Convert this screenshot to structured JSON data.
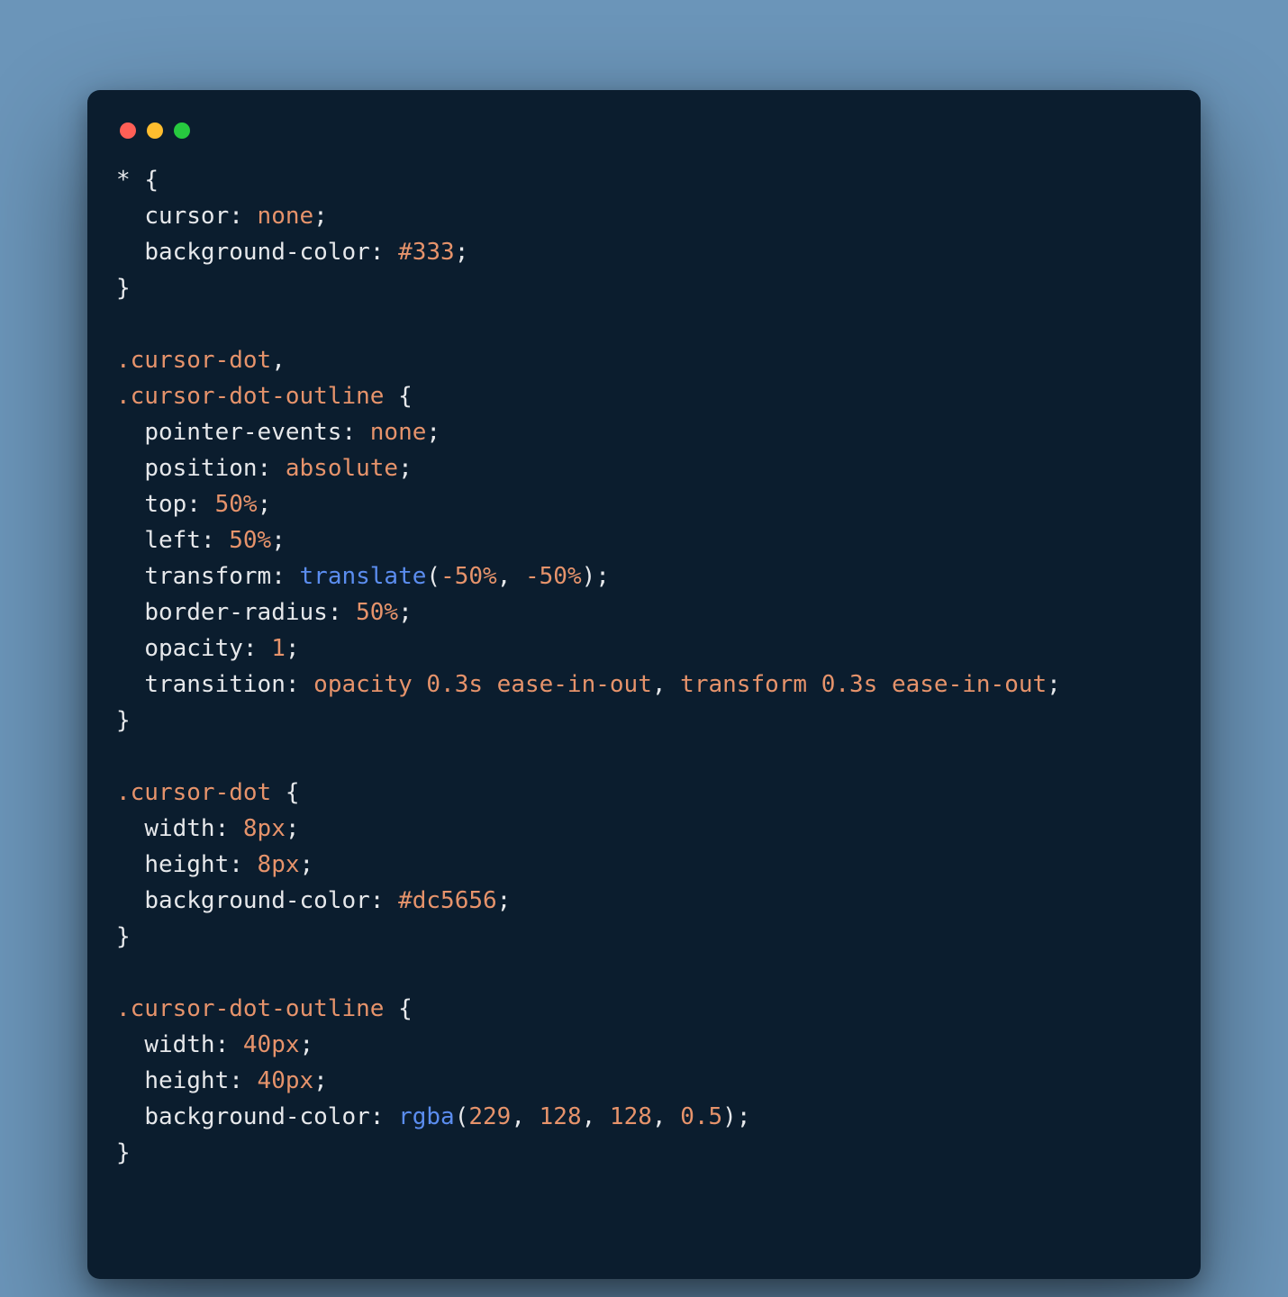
{
  "colors": {
    "bg_page": "#6b95b9",
    "bg_window": "#0b1d2e",
    "text_default": "#e6e8eb",
    "text_selector": "#e6936b",
    "text_value": "#e6936b",
    "text_func": "#5b8def",
    "tl_red": "#ff5f56",
    "tl_yellow": "#ffbd2e",
    "tl_green": "#27c93f"
  },
  "code": {
    "tokens": [
      {
        "t": "* ",
        "c": "c-punct"
      },
      {
        "t": "{",
        "c": "c-brace"
      },
      {
        "t": "\n"
      },
      {
        "t": "  "
      },
      {
        "t": "cursor",
        "c": "c-prop"
      },
      {
        "t": ": ",
        "c": "c-punct"
      },
      {
        "t": "none",
        "c": "c-val"
      },
      {
        "t": ";",
        "c": "c-punct"
      },
      {
        "t": "\n"
      },
      {
        "t": "  "
      },
      {
        "t": "background-color",
        "c": "c-prop"
      },
      {
        "t": ": ",
        "c": "c-punct"
      },
      {
        "t": "#333",
        "c": "c-val"
      },
      {
        "t": ";",
        "c": "c-punct"
      },
      {
        "t": "\n"
      },
      {
        "t": "}",
        "c": "c-brace"
      },
      {
        "t": "\n"
      },
      {
        "t": "\n"
      },
      {
        "t": ".cursor-dot",
        "c": "c-sel"
      },
      {
        "t": ",",
        "c": "c-punct"
      },
      {
        "t": "\n"
      },
      {
        "t": ".cursor-dot-outline",
        "c": "c-sel"
      },
      {
        "t": " {",
        "c": "c-brace"
      },
      {
        "t": "\n"
      },
      {
        "t": "  "
      },
      {
        "t": "pointer-events",
        "c": "c-prop"
      },
      {
        "t": ": ",
        "c": "c-punct"
      },
      {
        "t": "none",
        "c": "c-val"
      },
      {
        "t": ";",
        "c": "c-punct"
      },
      {
        "t": "\n"
      },
      {
        "t": "  "
      },
      {
        "t": "position",
        "c": "c-prop"
      },
      {
        "t": ": ",
        "c": "c-punct"
      },
      {
        "t": "absolute",
        "c": "c-val"
      },
      {
        "t": ";",
        "c": "c-punct"
      },
      {
        "t": "\n"
      },
      {
        "t": "  "
      },
      {
        "t": "top",
        "c": "c-prop"
      },
      {
        "t": ": ",
        "c": "c-punct"
      },
      {
        "t": "50%",
        "c": "c-val"
      },
      {
        "t": ";",
        "c": "c-punct"
      },
      {
        "t": "\n"
      },
      {
        "t": "  "
      },
      {
        "t": "left",
        "c": "c-prop"
      },
      {
        "t": ": ",
        "c": "c-punct"
      },
      {
        "t": "50%",
        "c": "c-val"
      },
      {
        "t": ";",
        "c": "c-punct"
      },
      {
        "t": "\n"
      },
      {
        "t": "  "
      },
      {
        "t": "transform",
        "c": "c-prop"
      },
      {
        "t": ": ",
        "c": "c-punct"
      },
      {
        "t": "translate",
        "c": "c-func"
      },
      {
        "t": "(",
        "c": "c-punct"
      },
      {
        "t": "-50%",
        "c": "c-val"
      },
      {
        "t": ", ",
        "c": "c-punct"
      },
      {
        "t": "-50%",
        "c": "c-val"
      },
      {
        "t": ")",
        "c": "c-punct"
      },
      {
        "t": ";",
        "c": "c-punct"
      },
      {
        "t": "\n"
      },
      {
        "t": "  "
      },
      {
        "t": "border-radius",
        "c": "c-prop"
      },
      {
        "t": ": ",
        "c": "c-punct"
      },
      {
        "t": "50%",
        "c": "c-val"
      },
      {
        "t": ";",
        "c": "c-punct"
      },
      {
        "t": "\n"
      },
      {
        "t": "  "
      },
      {
        "t": "opacity",
        "c": "c-prop"
      },
      {
        "t": ": ",
        "c": "c-punct"
      },
      {
        "t": "1",
        "c": "c-val"
      },
      {
        "t": ";",
        "c": "c-punct"
      },
      {
        "t": "\n"
      },
      {
        "t": "  "
      },
      {
        "t": "transition",
        "c": "c-prop"
      },
      {
        "t": ": ",
        "c": "c-punct"
      },
      {
        "t": "opacity 0.3s ease-in-out",
        "c": "c-val"
      },
      {
        "t": ", ",
        "c": "c-punct"
      },
      {
        "t": "transform 0.3s ease-in-out",
        "c": "c-val"
      },
      {
        "t": ";",
        "c": "c-punct"
      },
      {
        "t": "\n"
      },
      {
        "t": "}",
        "c": "c-brace"
      },
      {
        "t": "\n"
      },
      {
        "t": "\n"
      },
      {
        "t": ".cursor-dot",
        "c": "c-sel"
      },
      {
        "t": " {",
        "c": "c-brace"
      },
      {
        "t": "\n"
      },
      {
        "t": "  "
      },
      {
        "t": "width",
        "c": "c-prop"
      },
      {
        "t": ": ",
        "c": "c-punct"
      },
      {
        "t": "8px",
        "c": "c-val"
      },
      {
        "t": ";",
        "c": "c-punct"
      },
      {
        "t": "\n"
      },
      {
        "t": "  "
      },
      {
        "t": "height",
        "c": "c-prop"
      },
      {
        "t": ": ",
        "c": "c-punct"
      },
      {
        "t": "8px",
        "c": "c-val"
      },
      {
        "t": ";",
        "c": "c-punct"
      },
      {
        "t": "\n"
      },
      {
        "t": "  "
      },
      {
        "t": "background-color",
        "c": "c-prop"
      },
      {
        "t": ": ",
        "c": "c-punct"
      },
      {
        "t": "#dc5656",
        "c": "c-val"
      },
      {
        "t": ";",
        "c": "c-punct"
      },
      {
        "t": "\n"
      },
      {
        "t": "}",
        "c": "c-brace"
      },
      {
        "t": "\n"
      },
      {
        "t": "\n"
      },
      {
        "t": ".cursor-dot-outline",
        "c": "c-sel"
      },
      {
        "t": " {",
        "c": "c-brace"
      },
      {
        "t": "\n"
      },
      {
        "t": "  "
      },
      {
        "t": "width",
        "c": "c-prop"
      },
      {
        "t": ": ",
        "c": "c-punct"
      },
      {
        "t": "40px",
        "c": "c-val"
      },
      {
        "t": ";",
        "c": "c-punct"
      },
      {
        "t": "\n"
      },
      {
        "t": "  "
      },
      {
        "t": "height",
        "c": "c-prop"
      },
      {
        "t": ": ",
        "c": "c-punct"
      },
      {
        "t": "40px",
        "c": "c-val"
      },
      {
        "t": ";",
        "c": "c-punct"
      },
      {
        "t": "\n"
      },
      {
        "t": "  "
      },
      {
        "t": "background-color",
        "c": "c-prop"
      },
      {
        "t": ": ",
        "c": "c-punct"
      },
      {
        "t": "rgba",
        "c": "c-func"
      },
      {
        "t": "(",
        "c": "c-punct"
      },
      {
        "t": "229",
        "c": "c-val"
      },
      {
        "t": ", ",
        "c": "c-punct"
      },
      {
        "t": "128",
        "c": "c-val"
      },
      {
        "t": ", ",
        "c": "c-punct"
      },
      {
        "t": "128",
        "c": "c-val"
      },
      {
        "t": ", ",
        "c": "c-punct"
      },
      {
        "t": "0.5",
        "c": "c-val"
      },
      {
        "t": ")",
        "c": "c-punct"
      },
      {
        "t": ";",
        "c": "c-punct"
      },
      {
        "t": "\n"
      },
      {
        "t": "}",
        "c": "c-brace"
      }
    ]
  }
}
